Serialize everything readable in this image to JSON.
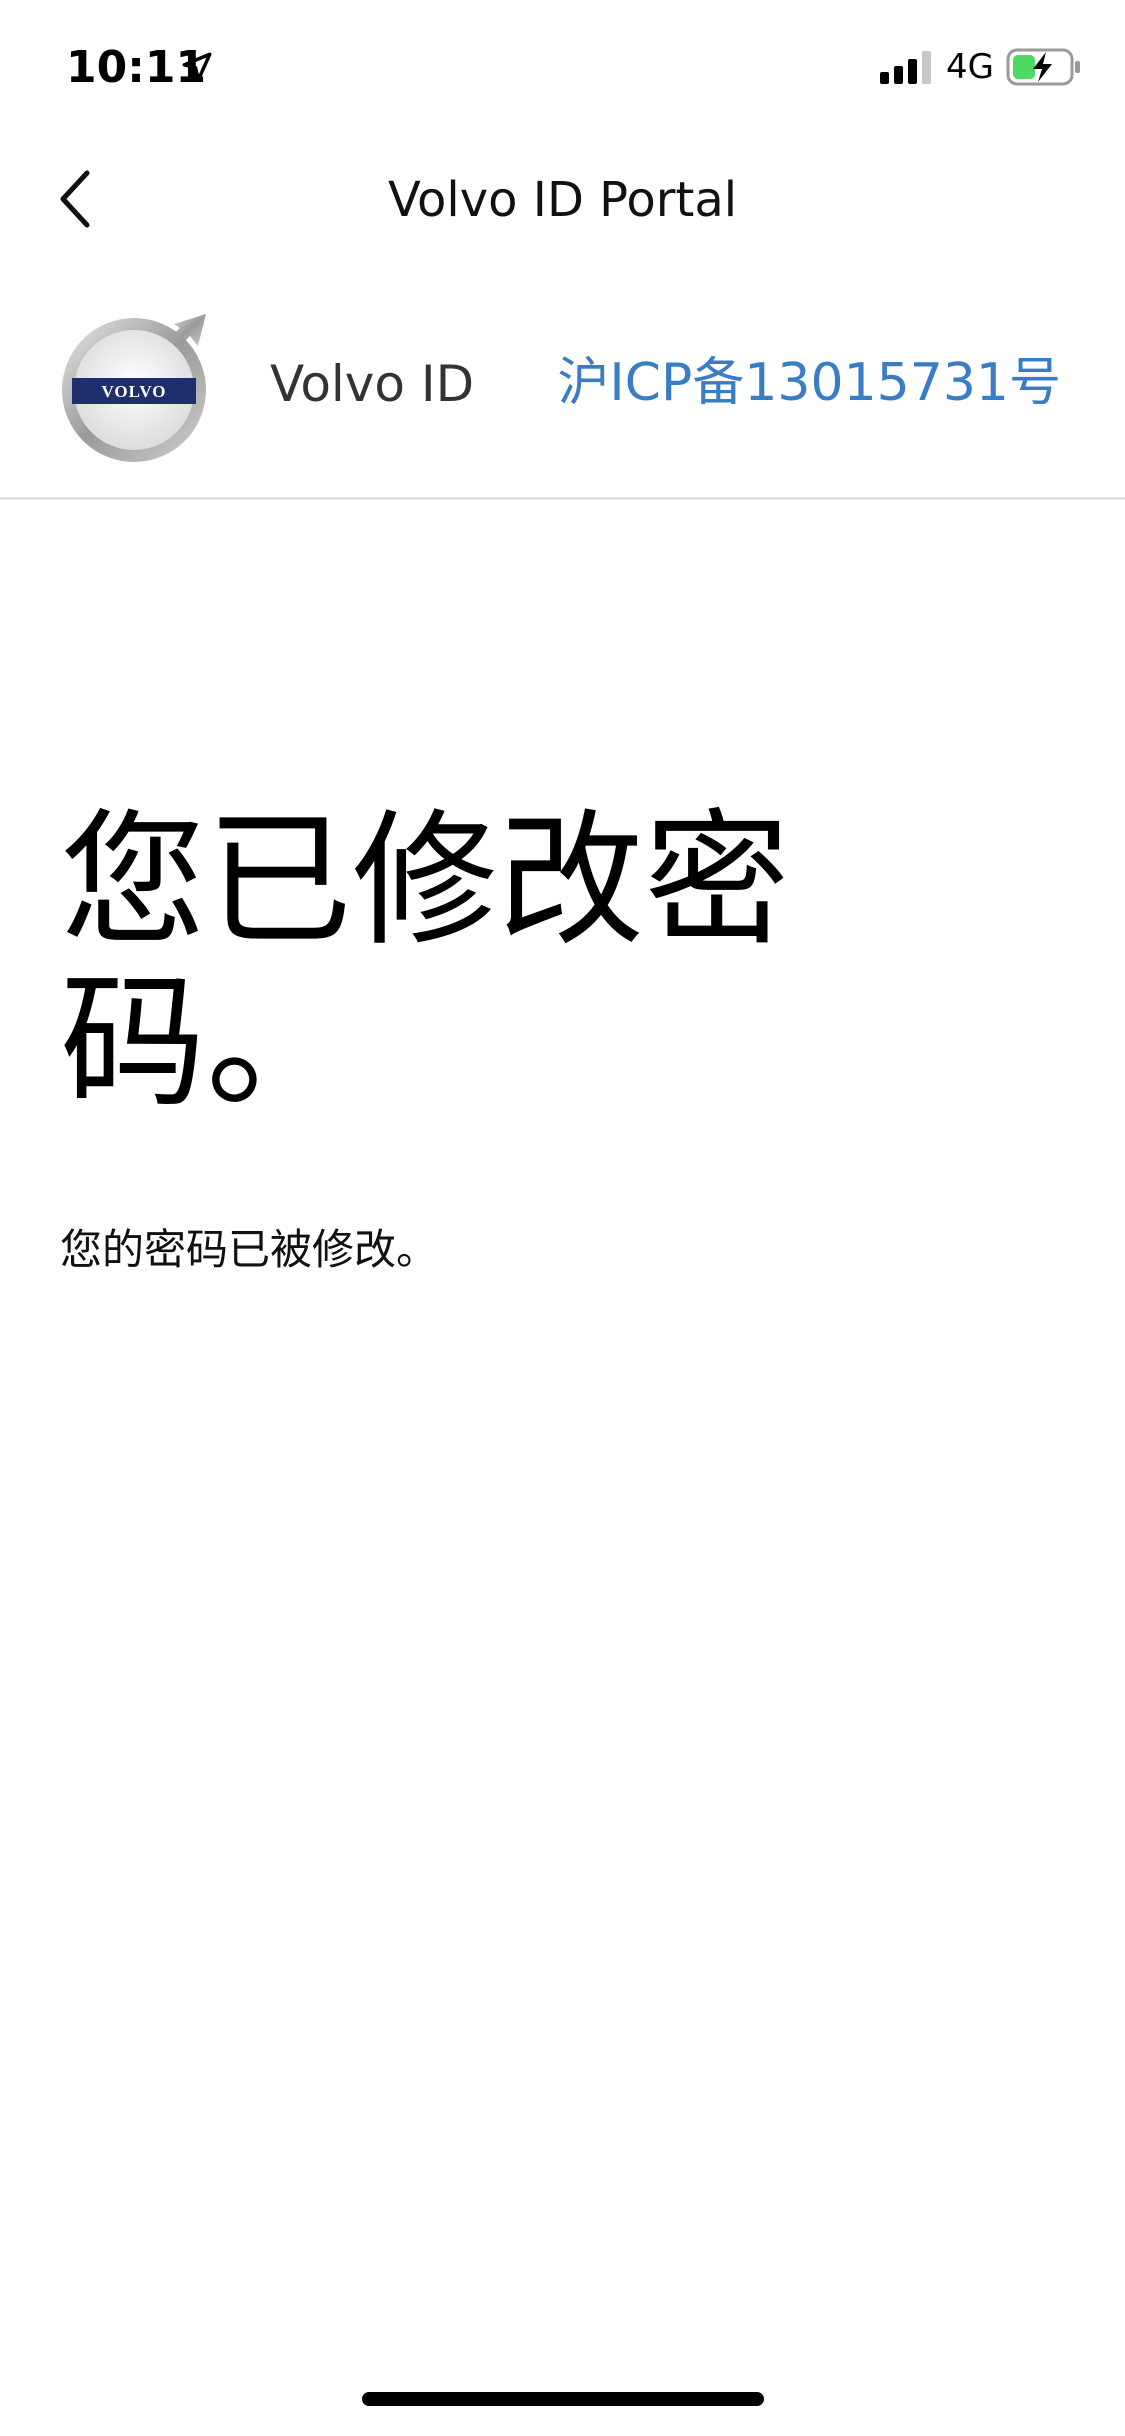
{
  "status_bar": {
    "time": "10:11",
    "network": "4G"
  },
  "nav": {
    "title": "Volvo ID Portal"
  },
  "header": {
    "brand_name": "Volvo ID",
    "icp_text": "沪ICP备13015731号",
    "logo_text": "VOLVO"
  },
  "main": {
    "heading": "您已修改密码。",
    "message": "您的密码已被修改。"
  },
  "colors": {
    "link": "#3a7dc4",
    "divider": "#e3e3e3",
    "battery_green": "#4cd964"
  }
}
